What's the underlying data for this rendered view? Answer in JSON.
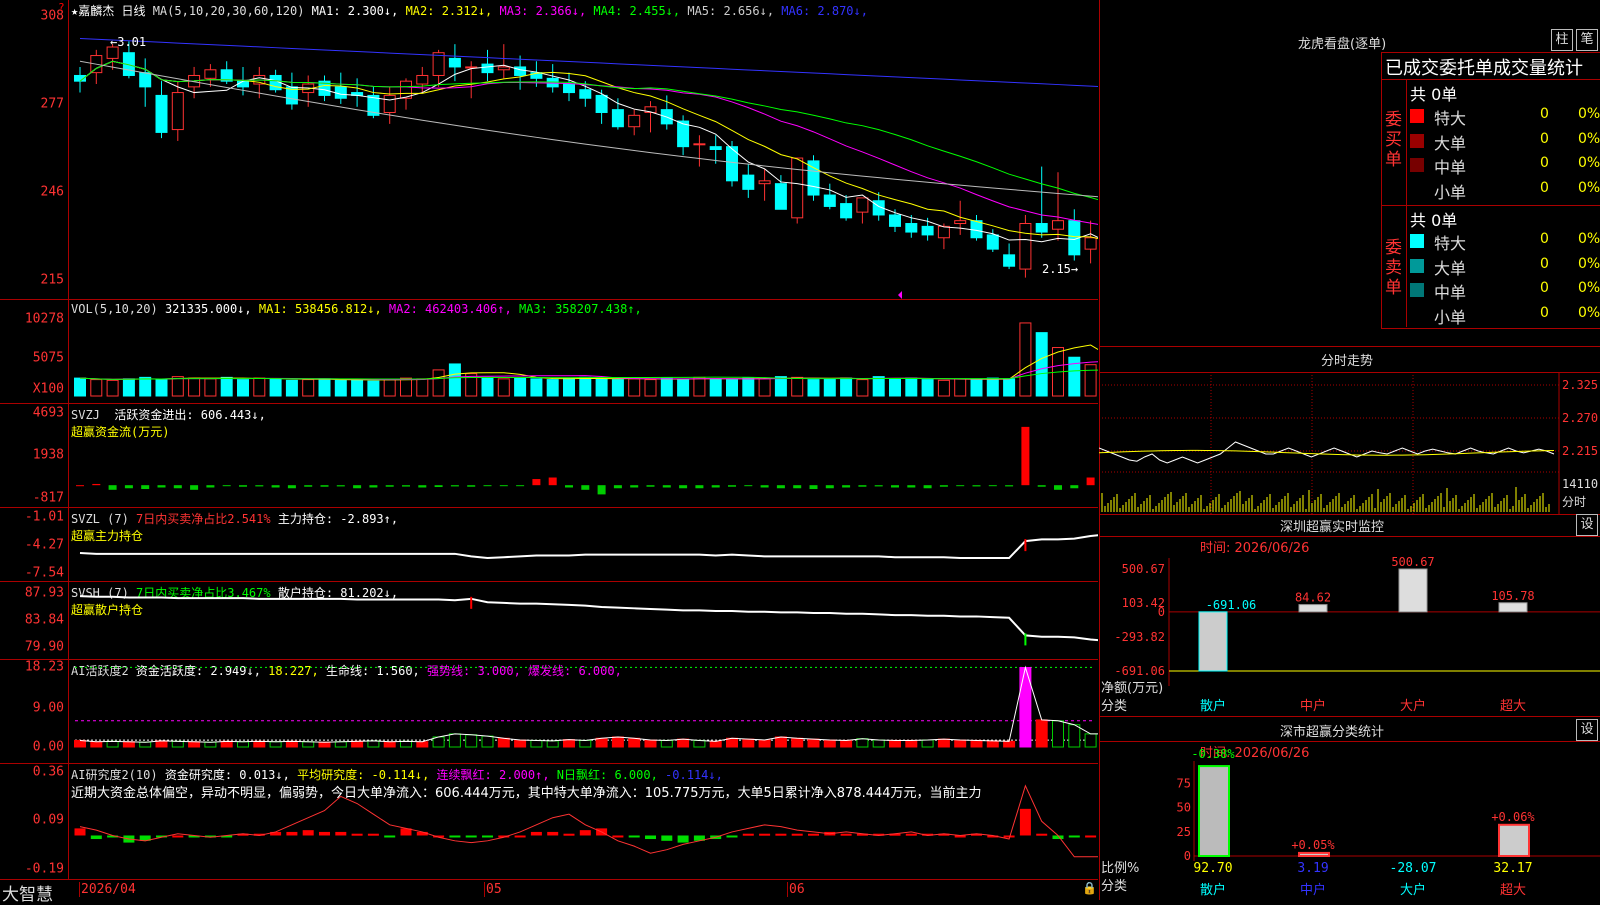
{
  "chart_data": [
    {
      "type": "candlestick",
      "title": "嘉麟杰 日线",
      "ylim": [
        212,
        310
      ],
      "y_ticks": [
        "308",
        "277",
        "246",
        "215"
      ],
      "indicator_line": "MA(5,10,20,30,60,120)",
      "ma_legend": [
        {
          "name": "MA1",
          "value": "2.300↓",
          "color": "#ffffff"
        },
        {
          "name": "MA2",
          "value": "2.312↓",
          "color": "#ffff00"
        },
        {
          "name": "MA3",
          "value": "2.366↓",
          "color": "#ff00ff"
        },
        {
          "name": "MA4",
          "value": "2.455↓",
          "color": "#00ff00"
        },
        {
          "name": "MA5",
          "value": "2.656↓",
          "color": "#cccccc"
        },
        {
          "name": "MA6",
          "value": "2.870↓",
          "color": "#3333ff"
        }
      ],
      "annotations": [
        "←3.01",
        "2.15→"
      ],
      "ohlc": [
        [
          287,
          290,
          281,
          285
        ],
        [
          288,
          296,
          284,
          294
        ],
        [
          293,
          298,
          289,
          297
        ],
        [
          295,
          299,
          286,
          287
        ],
        [
          288,
          293,
          276,
          283
        ],
        [
          280,
          285,
          265,
          267
        ],
        [
          268,
          285,
          264,
          281
        ],
        [
          283,
          290,
          279,
          287
        ],
        [
          286,
          291,
          283,
          289
        ],
        [
          289,
          292,
          284,
          285
        ],
        [
          285,
          290,
          280,
          283
        ],
        [
          284,
          290,
          279,
          287
        ],
        [
          287,
          289,
          281,
          282
        ],
        [
          283,
          288,
          275,
          277
        ],
        [
          281,
          287,
          276,
          284
        ],
        [
          285,
          287,
          278,
          280
        ],
        [
          283,
          288,
          277,
          279
        ],
        [
          281,
          286,
          276,
          280
        ],
        [
          280,
          283,
          272,
          273
        ],
        [
          274,
          283,
          270,
          280
        ],
        [
          279,
          286,
          275,
          285
        ],
        [
          284,
          290,
          281,
          287
        ],
        [
          287,
          296,
          283,
          295
        ],
        [
          293,
          298,
          285,
          290
        ],
        [
          290,
          292,
          279,
          290
        ],
        [
          291,
          296,
          285,
          288
        ],
        [
          289,
          298,
          286,
          290
        ],
        [
          290,
          294,
          282,
          287
        ],
        [
          288,
          292,
          283,
          286
        ],
        [
          286,
          291,
          281,
          283
        ],
        [
          284,
          288,
          278,
          281
        ],
        [
          282,
          285,
          276,
          279
        ],
        [
          280,
          282,
          270,
          274
        ],
        [
          275,
          279,
          268,
          269
        ],
        [
          269,
          275,
          266,
          273
        ],
        [
          274,
          278,
          267,
          276
        ],
        [
          275,
          280,
          268,
          270
        ],
        [
          271,
          273,
          259,
          262
        ],
        [
          263,
          266,
          255,
          263
        ],
        [
          262,
          266,
          256,
          261
        ],
        [
          262,
          264,
          248,
          250
        ],
        [
          252,
          256,
          244,
          247
        ],
        [
          249,
          254,
          243,
          250
        ],
        [
          249,
          252,
          240,
          240
        ],
        [
          237,
          250,
          235,
          258
        ],
        [
          257,
          259,
          243,
          245
        ],
        [
          245,
          249,
          240,
          241
        ],
        [
          242,
          245,
          236,
          237
        ],
        [
          239,
          244,
          235,
          244
        ],
        [
          243,
          246,
          236,
          238
        ],
        [
          238,
          240,
          232,
          234
        ],
        [
          235,
          238,
          230,
          232
        ],
        [
          234,
          237,
          229,
          231
        ],
        [
          230,
          235,
          226,
          234
        ],
        [
          235,
          243,
          231,
          236
        ],
        [
          236,
          238,
          229,
          230
        ],
        [
          231,
          233,
          225,
          226
        ],
        [
          224,
          228,
          219,
          220
        ],
        [
          219,
          238,
          216,
          235
        ],
        [
          235,
          255,
          230,
          232
        ],
        [
          233,
          253,
          229,
          236
        ],
        [
          236,
          240,
          222,
          224
        ],
        [
          226,
          236,
          221,
          230
        ],
        [
          229,
          232,
          221,
          221
        ]
      ]
    },
    {
      "type": "bar",
      "title": "VOL(5,10,20)",
      "y_ticks": [
        "10278",
        "5075",
        "X100"
      ],
      "ylim": [
        0,
        11000
      ],
      "legend": [
        {
          "name": "",
          "value": "321335.000↓",
          "color": "#ffffff"
        },
        {
          "name": "MA1",
          "value": "538456.812↓",
          "color": "#ffff00"
        },
        {
          "name": "MA2",
          "value": "462403.406↑",
          "color": "#ff00ff"
        },
        {
          "name": "MA3",
          "value": "358207.438↑",
          "color": "#00ff00"
        }
      ],
      "values": [
        2400,
        2200,
        2100,
        2300,
        2500,
        2200,
        2600,
        2400,
        2300,
        2500,
        2200,
        2400,
        2300,
        2100,
        2200,
        2300,
        2100,
        2200,
        2000,
        2200,
        2400,
        2300,
        3500,
        4300,
        3000,
        2500,
        2300,
        2400,
        2300,
        2200,
        2400,
        2500,
        2300,
        2200,
        2300,
        2200,
        2400,
        2200,
        2500,
        2300,
        2200,
        2400,
        2300,
        2600,
        2500,
        2200,
        2300,
        2400,
        2200,
        2600,
        2300,
        2400,
        2200,
        2100,
        2300,
        2200,
        2400,
        2300,
        9800,
        8500,
        6500,
        5200,
        4200,
        3200
      ]
    },
    {
      "type": "bar",
      "title": "SVZJ",
      "y_ticks": [
        "4693",
        "1938",
        "-817"
      ],
      "ylim": [
        -900,
        4900
      ],
      "legend_text": "活跃资金进出: 606.443↓,",
      "sub_title": "超赢资金流(万元)",
      "values": [
        0,
        80,
        -300,
        -200,
        -250,
        -150,
        -200,
        -300,
        -150,
        -50,
        -100,
        -80,
        -150,
        -200,
        -100,
        -100,
        -80,
        -200,
        -150,
        -100,
        -90,
        -150,
        -120,
        -80,
        -100,
        -60,
        -50,
        -50,
        400,
        500,
        -150,
        -300,
        -600,
        -200,
        -150,
        -100,
        -150,
        -200,
        -200,
        -150,
        -100,
        -60,
        -150,
        -200,
        -200,
        -250,
        -200,
        -150,
        -100,
        -80,
        -150,
        -150,
        -200,
        -100,
        -60,
        -80,
        -50,
        -80,
        3800,
        -100,
        -300,
        -200,
        500,
        400
      ]
    },
    {
      "type": "line",
      "title": "SVZL (7)",
      "y_ticks": [
        "-1.01",
        "-4.27",
        "-7.54"
      ],
      "ylim": [
        -7.8,
        -0.6
      ],
      "legend_text_red": "7日内买卖净占比2.541%",
      "legend_text": "主力持仓: -2.893↑,",
      "sub_title": "超赢主力持仓",
      "values": [
        -5.2,
        -5.3,
        -5.3,
        -5.3,
        -5.3,
        -5.3,
        -5.3,
        -5.3,
        -5.3,
        -5.3,
        -5.3,
        -5.3,
        -5.3,
        -5.3,
        -5.3,
        -5.3,
        -5.3,
        -5.3,
        -5.3,
        -5.3,
        -5.3,
        -5.3,
        -5.3,
        -5.3,
        -5.6,
        -5.8,
        -5.7,
        -5.6,
        -5.5,
        -5.5,
        -5.5,
        -5.4,
        -5.4,
        -5.4,
        -5.4,
        -5.4,
        -5.4,
        -5.4,
        -5.4,
        -5.5,
        -5.4,
        -5.5,
        -5.6,
        -5.6,
        -5.6,
        -5.6,
        -5.6,
        -5.6,
        -5.6,
        -5.6,
        -5.7,
        -5.7,
        -5.7,
        -5.7,
        -5.8,
        -5.8,
        -5.8,
        -5.8,
        -3.8,
        -3.6,
        -3.6,
        -3.5,
        -3.2,
        -3.0
      ]
    },
    {
      "type": "line",
      "title": "SVSH (7)",
      "y_ticks": [
        "87.93",
        "83.84",
        "79.90"
      ],
      "ylim": [
        79.0,
        88.6
      ],
      "legend_text_green": "7日内买卖净占比3.467%",
      "legend_text": "散户持仓: 81.202↓,",
      "sub_title": "超赢散户持仓",
      "values": [
        87.4,
        87.3,
        87.3,
        87.2,
        87.2,
        87.2,
        87.1,
        87.1,
        87.1,
        87.1,
        87.1,
        87.0,
        87.0,
        87.0,
        87.0,
        87.0,
        87.0,
        86.9,
        86.9,
        86.9,
        86.9,
        86.9,
        86.9,
        86.8,
        87.0,
        86.5,
        86.4,
        86.3,
        86.3,
        86.2,
        86.1,
        86.0,
        85.8,
        85.7,
        85.6,
        85.5,
        85.4,
        85.3,
        85.3,
        85.2,
        85.2,
        85.1,
        85.1,
        85.0,
        85.0,
        84.9,
        84.9,
        84.8,
        84.8,
        84.7,
        84.6,
        84.6,
        84.5,
        84.5,
        84.4,
        84.4,
        84.3,
        84.2,
        81.6,
        81.4,
        81.4,
        81.3,
        81.0,
        80.8
      ]
    },
    {
      "type": "bar",
      "title": "AI活跃度2",
      "y_ticks": [
        "18.23",
        "9.00",
        "0.00"
      ],
      "ylim": [
        0,
        19
      ],
      "legend": [
        {
          "name": "资金活跃度",
          "value": "2.949↓",
          "color": "#ffffff"
        },
        {
          "name": "",
          "value": "18.227",
          "color": "#ffff00"
        },
        {
          "name": "生命线",
          "value": "1.560",
          "color": "#ffffff"
        },
        {
          "name": "强势线",
          "value": "3.000",
          "color": "#ff00ff"
        },
        {
          "name": "爆发线",
          "value": "6.000",
          "color": "#ff00ff"
        }
      ],
      "values": [
        1.5,
        1.2,
        1.3,
        1.2,
        1.1,
        1.4,
        1.3,
        1.2,
        1.1,
        1.3,
        1.2,
        1.3,
        1.2,
        1.3,
        1.2,
        1.1,
        1.2,
        1.3,
        1.4,
        1.2,
        1.3,
        1.2,
        2.3,
        3.0,
        2.8,
        2.5,
        2.0,
        1.6,
        1.5,
        1.4,
        1.7,
        1.5,
        2.0,
        2.3,
        2.0,
        1.6,
        1.5,
        1.8,
        1.5,
        1.3,
        2.0,
        1.8,
        1.6,
        2.3,
        2.0,
        1.8,
        1.6,
        1.5,
        1.9,
        1.6,
        1.5,
        1.5,
        1.6,
        1.8,
        1.6,
        1.5,
        1.4,
        1.3,
        18.2,
        6.2,
        6.0,
        5.1,
        3.0,
        3.0
      ],
      "colors": [
        "r",
        "r",
        "g",
        "r",
        "g",
        "r",
        "g",
        "r",
        "g",
        "r",
        "g",
        "r",
        "g",
        "r",
        "g",
        "r",
        "g",
        "r",
        "g",
        "r",
        "g",
        "r",
        "g",
        "g",
        "g",
        "g",
        "r",
        "r",
        "g",
        "g",
        "r",
        "g",
        "r",
        "r",
        "r",
        "r",
        "g",
        "r",
        "g",
        "r",
        "r",
        "r",
        "r",
        "r",
        "r",
        "r",
        "r",
        "r",
        "g",
        "g",
        "r",
        "r",
        "g",
        "r",
        "r",
        "r",
        "r",
        "r",
        "m",
        "r",
        "g",
        "g",
        "g",
        "r"
      ]
    },
    {
      "type": "bar",
      "title": "AI研究度2(10)",
      "y_ticks": [
        "0.36",
        "0.09",
        "-0.19"
      ],
      "ylim": [
        -0.2,
        0.38
      ],
      "legend": [
        {
          "name": "资金研究度",
          "value": "0.013↓",
          "color": "#ffffff"
        },
        {
          "name": "平均研究度",
          "value": "-0.114↓",
          "color": "#ffff00"
        },
        {
          "name": "连续飘红",
          "value": "2.000↑",
          "color": "#ff00ff"
        },
        {
          "name": "N日飘红",
          "value": "6.000",
          "color": "#00ff00"
        },
        {
          "name": "",
          "value": "-0.114↓",
          "color": "#3333ff"
        }
      ],
      "commentary": "近期大资金总体偏空，异动不明显，偏弱势，今日大单净流入：606.444万元，其中特大单净流入：105.775万元，大单5日累计净入878.444万元，当前主力",
      "values": [
        0.04,
        -0.02,
        -0.01,
        -0.04,
        -0.03,
        -0.01,
        0.0,
        -0.01,
        -0.01,
        -0.01,
        0.01,
        0.01,
        0.02,
        0.02,
        0.03,
        0.02,
        0.02,
        0.01,
        0.01,
        -0.01,
        0.04,
        0.02,
        0.0,
        -0.01,
        -0.01,
        -0.01,
        0.0,
        0.0,
        0.02,
        0.02,
        0.01,
        0.03,
        0.04,
        0.0,
        -0.01,
        -0.02,
        -0.03,
        -0.04,
        -0.03,
        -0.02,
        -0.01,
        0.01,
        0.01,
        0.01,
        0.01,
        0.01,
        0.02,
        0.01,
        0.01,
        0.01,
        0.01,
        0.01,
        0.01,
        0.01,
        0.0,
        0.01,
        0.0,
        0.0,
        0.15,
        0.01,
        -0.02,
        -0.01,
        0.0,
        0.01
      ],
      "line_values": [
        0.05,
        0.03,
        0.0,
        -0.02,
        -0.03,
        -0.01,
        0.01,
        0.0,
        -0.01,
        0.0,
        0.01,
        0.0,
        0.02,
        0.06,
        0.1,
        0.14,
        0.22,
        0.18,
        0.12,
        0.06,
        0.04,
        0.02,
        -0.01,
        -0.03,
        -0.04,
        -0.03,
        -0.01,
        0.02,
        0.06,
        0.1,
        0.12,
        0.06,
        0.02,
        -0.03,
        -0.06,
        -0.1,
        -0.08,
        -0.05,
        -0.03,
        -0.01,
        0.02,
        0.04,
        0.06,
        0.05,
        0.03,
        0.02,
        0.01,
        0.02,
        0.01,
        0.0,
        0.01,
        0.02,
        0.0,
        0.01,
        0.0,
        0.01,
        0.0,
        -0.02,
        0.28,
        0.08,
        0.0,
        -0.12,
        -0.12,
        -0.12
      ]
    },
    {
      "type": "line",
      "title": "分时走势",
      "y_ticks": [
        "2.325",
        "2.270",
        "2.215",
        "14110",
        "分时"
      ],
      "ylim": [
        2.19,
        2.34
      ],
      "values": [
        2.22,
        2.215,
        2.21,
        2.205,
        2.2,
        2.198,
        2.205,
        2.21,
        2.2,
        2.195,
        2.2,
        2.205,
        2.2,
        2.195,
        2.2,
        2.205,
        2.21,
        2.22,
        2.23,
        2.225,
        2.22,
        2.215,
        2.21,
        2.21,
        2.215,
        2.22,
        2.215,
        2.21,
        2.205,
        2.21,
        2.215,
        2.22,
        2.215,
        2.21,
        2.205,
        2.21,
        2.215,
        2.212,
        2.21,
        2.215,
        2.22,
        2.215,
        2.21,
        2.215,
        2.218,
        2.215,
        2.212,
        2.21,
        2.215,
        2.22,
        2.215,
        2.212,
        2.21,
        2.215,
        2.22,
        2.215,
        2.212,
        2.215,
        2.218,
        2.215,
        2.21
      ]
    },
    {
      "type": "bar",
      "title": "深圳超赢实时监控",
      "categories": [
        "散户",
        "中户",
        "大户",
        "超大"
      ],
      "values": [
        -691.06,
        84.62,
        500.67,
        105.78
      ],
      "ylim": [
        -691.06,
        500.67
      ],
      "y_ticks": [
        "500.67",
        "103.42",
        "0",
        "-293.82",
        "-691.06"
      ],
      "xlabel": "净额(万元)分类"
    },
    {
      "type": "bar",
      "title": "深市超赢分类统计",
      "categories": [
        "散户",
        "中户",
        "大户",
        "超大"
      ],
      "values": [
        92.7,
        3.19,
        -28.07,
        32.17
      ],
      "top_labels": [
        "-0.38%",
        "+0.05%",
        "",
        "+0.06%"
      ],
      "ylim": [
        0,
        100
      ],
      "y_ticks": [
        "75",
        "50",
        "25",
        "0"
      ],
      "xlabel": "比例%分类"
    }
  ],
  "main_axis_dates": [
    "2026/04",
    "05",
    "06"
  ],
  "brand": "大智慧",
  "longhu": {
    "title": "龙虎看盘(逐单)",
    "btn_zhu": "柱",
    "btn_bi": "笔",
    "header": "已成交委托单成交量统计",
    "buy_label": "委买单",
    "sell_label": "委卖单",
    "buy_total": "共 0单",
    "sell_total": "共 0单",
    "buy_rows": [
      {
        "name": "特大",
        "count": "0",
        "pct": "0%",
        "color": "#ff0000"
      },
      {
        "name": "大单",
        "count": "0",
        "pct": "0%",
        "color": "#990000"
      },
      {
        "name": "中单",
        "count": "0",
        "pct": "0%",
        "color": "#770000"
      },
      {
        "name": "小单",
        "count": "0",
        "pct": "0%",
        "color": "#000000"
      }
    ],
    "sell_rows": [
      {
        "name": "特大",
        "count": "0",
        "pct": "0%",
        "color": "#00ffff"
      },
      {
        "name": "大单",
        "count": "0",
        "pct": "0%",
        "color": "#009999"
      },
      {
        "name": "中单",
        "count": "0",
        "pct": "0%",
        "color": "#007777"
      },
      {
        "name": "小单",
        "count": "0",
        "pct": "0%",
        "color": "#000000"
      }
    ]
  },
  "monitor": {
    "date": "时间: 2026/06/26",
    "settings": "设"
  },
  "classify": {
    "date": "时间: 2026/06/26",
    "settings": "设"
  }
}
